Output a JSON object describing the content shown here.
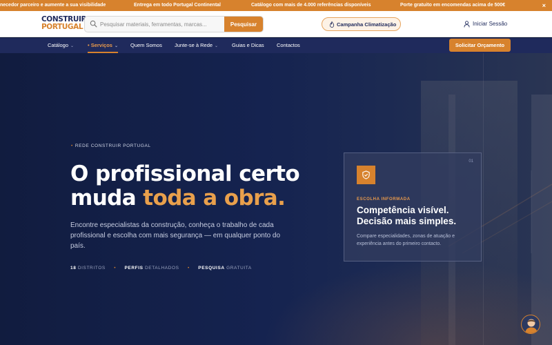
{
  "ticker": {
    "messages": [
      "necedor parceiro e aumente a sua visibilidade",
      "Entrega em todo Portugal Continental",
      "Catálogo com mais de 4.000 referências disponíveis",
      "Porte gratuito em encomendas acima de 500€"
    ],
    "close": "×"
  },
  "header": {
    "logo_line1": "CONSTRUIR",
    "logo_line2": "PORTUGAL",
    "search_placeholder": "Pesquisar materiais, ferramentas, marcas...",
    "search_button": "Pesquisar",
    "campaign": "Campanha Climatização",
    "login": "Iniciar Sessão"
  },
  "nav": {
    "items": [
      {
        "label": "Catálogo",
        "chevron": "⌄"
      },
      {
        "label": "• Serviços",
        "chevron": "⌄"
      },
      {
        "label": "Quem Somos"
      },
      {
        "label": "Junte-se à Rede",
        "chevron": "⌄"
      },
      {
        "label": "Guias e Dicas"
      },
      {
        "label": "Contactos"
      }
    ],
    "cta": "Solicitar Orçamento"
  },
  "hero": {
    "kicker": "REDE CONSTRUIR PORTUGAL",
    "headline_line1": "O profissional certo",
    "headline_line2a": "muda ",
    "headline_line2b": "toda a obra.",
    "lead": "Encontre especialistas da construção, conheça o trabalho de cada profissional e escolha com mais segurança — em qualquer ponto do país.",
    "stats": [
      {
        "strong": "18",
        "text": "DISTRITOS"
      },
      {
        "strong": "PERFIS",
        "text": "DETALHADOS"
      },
      {
        "strong": "PESQUISA",
        "text": "GRATUITA"
      }
    ]
  },
  "card": {
    "number": "01",
    "kicker": "ESCOLHA INFORMADA",
    "title": "Competência visível. Decisão mais simples.",
    "description": "Compare especialidades, zonas de atuação e experiência antes do primeiro contacto."
  },
  "colors": {
    "accent": "#d7822d",
    "navy": "#1f2a5c",
    "highlight": "#e9a04c"
  }
}
